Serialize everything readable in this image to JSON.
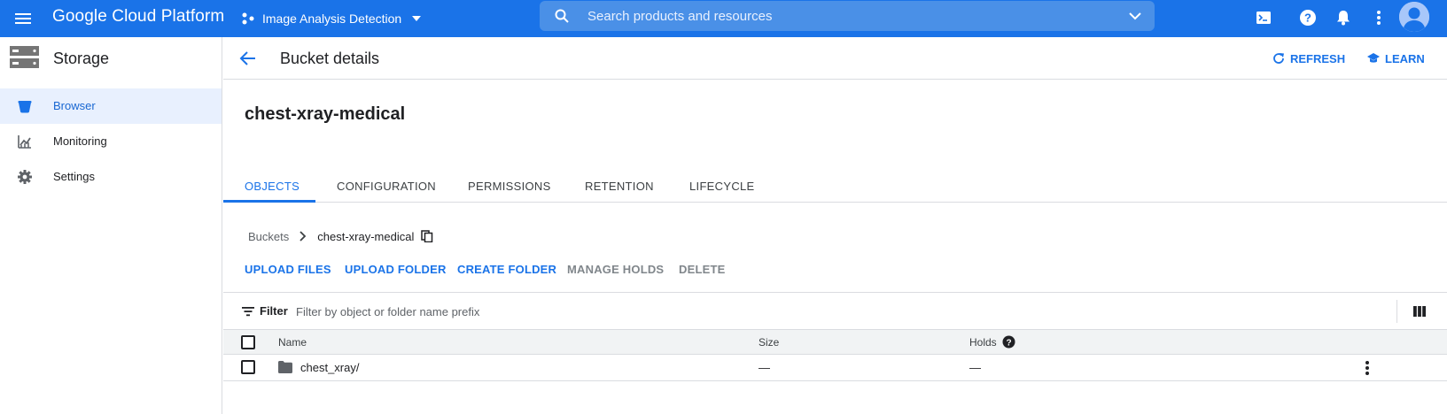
{
  "topbar": {
    "logo": "Google Cloud Platform",
    "project": "Image Analysis Detection",
    "search_placeholder": "Search products and resources",
    "brand_color": "#1a73e8"
  },
  "sidebar": {
    "title": "Storage",
    "items": [
      {
        "label": "Browser",
        "icon": "bucket-icon",
        "active": true
      },
      {
        "label": "Monitoring",
        "icon": "chart-icon",
        "active": false
      },
      {
        "label": "Settings",
        "icon": "gear-icon",
        "active": false
      }
    ]
  },
  "header": {
    "title": "Bucket details",
    "refresh_label": "REFRESH",
    "learn_label": "LEARN"
  },
  "bucket": {
    "name": "chest-xray-medical"
  },
  "tabs": [
    {
      "label": "OBJECTS",
      "active": true
    },
    {
      "label": "CONFIGURATION",
      "active": false
    },
    {
      "label": "PERMISSIONS",
      "active": false
    },
    {
      "label": "RETENTION",
      "active": false
    },
    {
      "label": "LIFECYCLE",
      "active": false
    }
  ],
  "breadcrumb": {
    "root": "Buckets",
    "current": "chest-xray-medical"
  },
  "actions": [
    {
      "label": "UPLOAD FILES",
      "enabled": true
    },
    {
      "label": "UPLOAD FOLDER",
      "enabled": true
    },
    {
      "label": "CREATE FOLDER",
      "enabled": true
    },
    {
      "label": "MANAGE HOLDS",
      "enabled": false
    },
    {
      "label": "DELETE",
      "enabled": false
    }
  ],
  "filter": {
    "label": "Filter",
    "placeholder": "Filter by object or folder name prefix"
  },
  "table": {
    "columns": {
      "name": "Name",
      "size": "Size",
      "holds": "Holds"
    },
    "rows": [
      {
        "name": "chest_xray/",
        "size": "—",
        "holds": "—"
      }
    ]
  }
}
